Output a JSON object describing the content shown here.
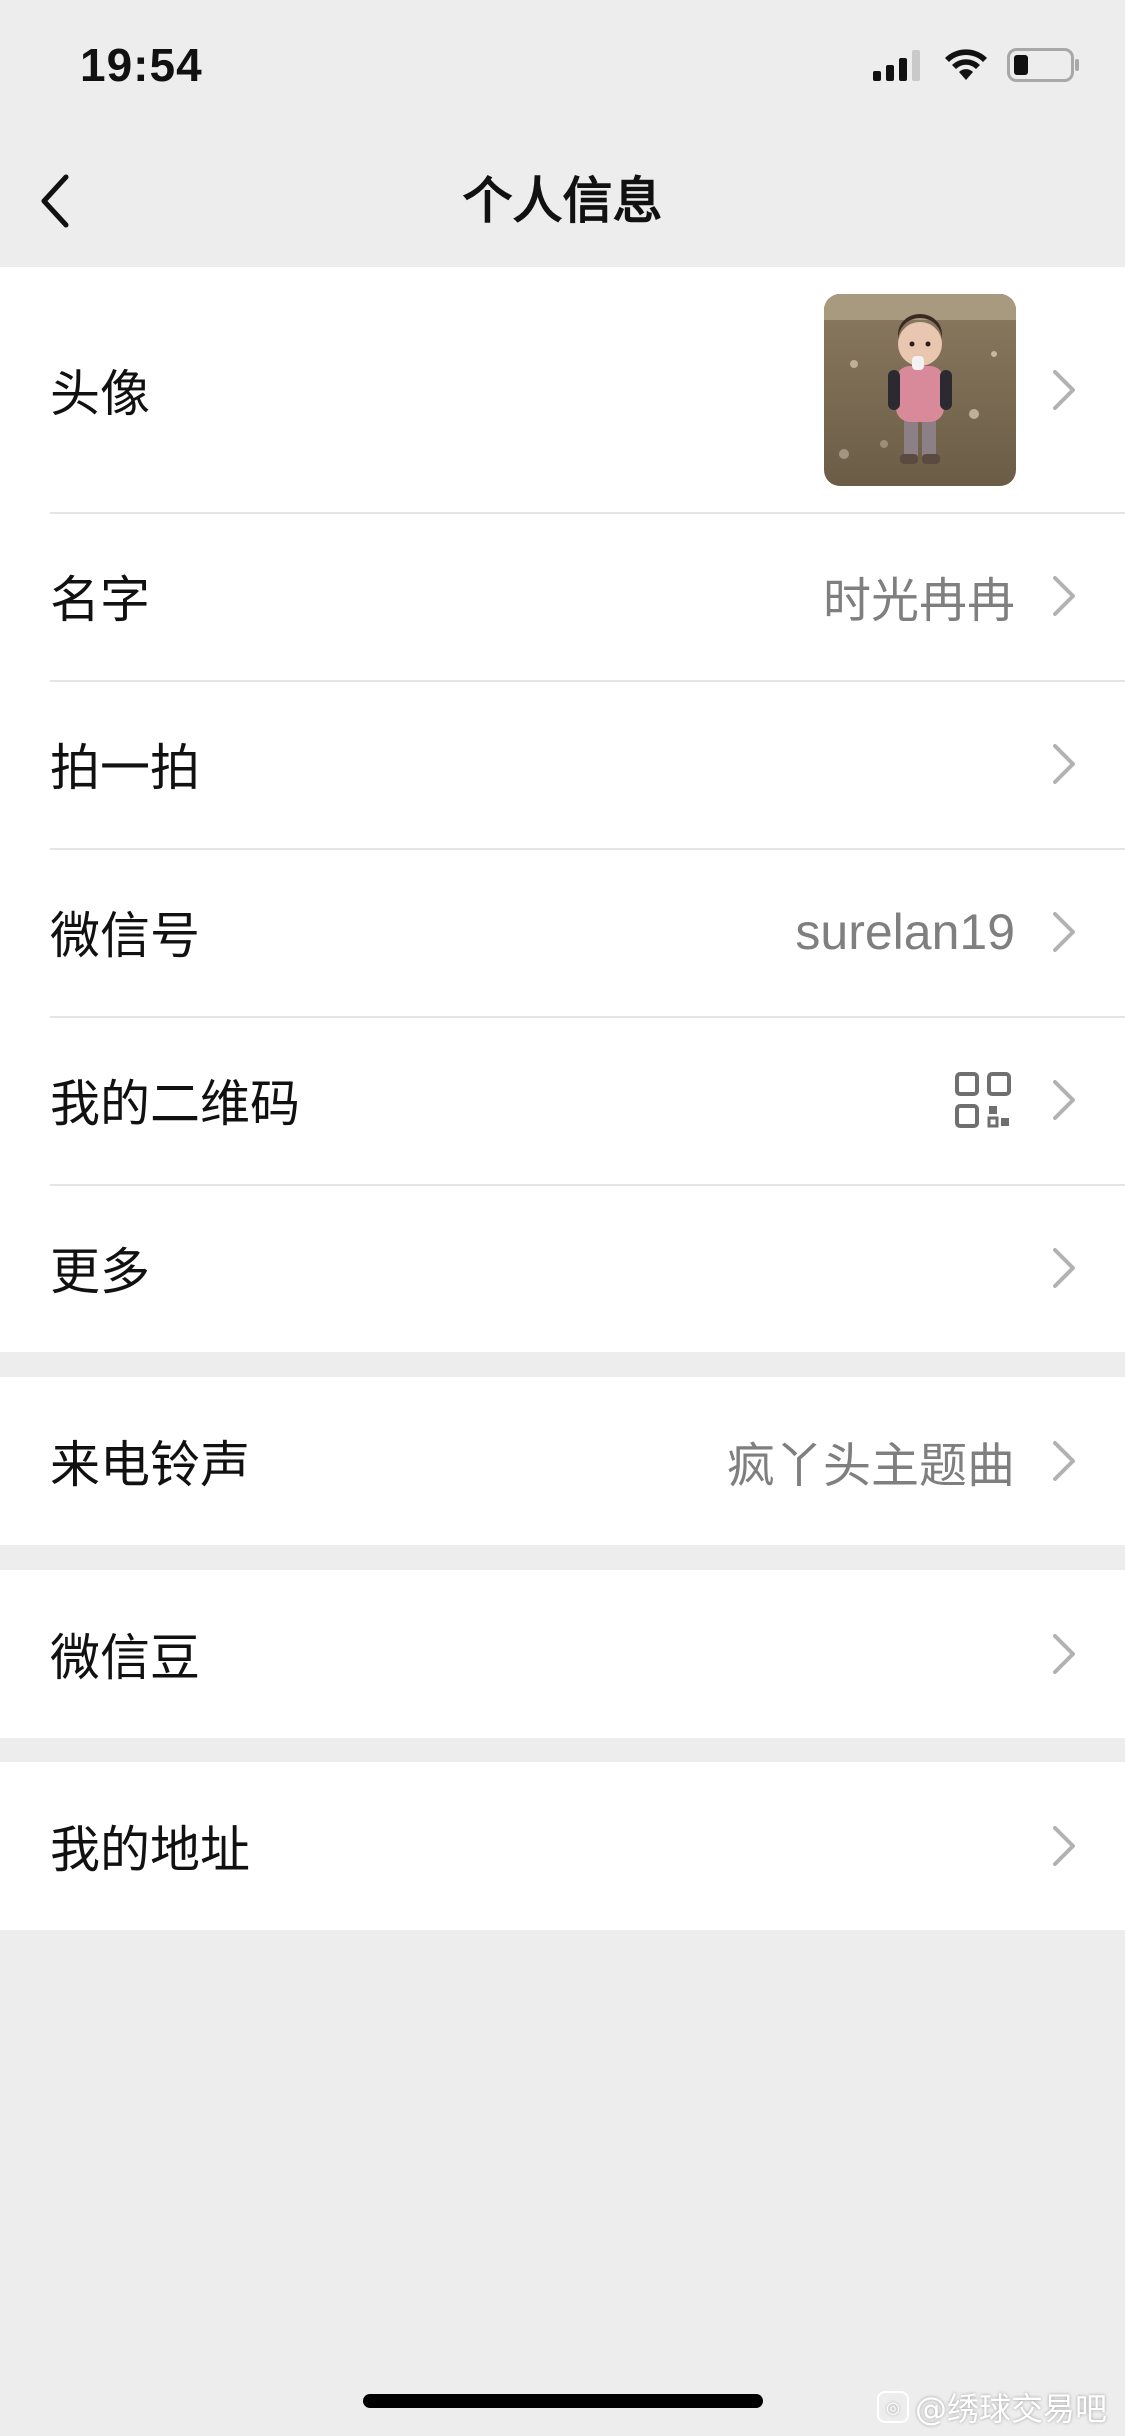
{
  "status_bar": {
    "time": "19:54",
    "icons": [
      "cellular-signal-icon",
      "wifi-icon",
      "battery-icon"
    ]
  },
  "nav": {
    "back_icon": "chevron-left-icon",
    "title": "个人信息"
  },
  "profile_group": {
    "avatar_label": "头像",
    "rows": [
      {
        "label": "名字",
        "value": "时光冉冉"
      },
      {
        "label": "拍一拍",
        "value": ""
      },
      {
        "label": "微信号",
        "value": "surelan19"
      },
      {
        "label": "我的二维码",
        "value": ""
      },
      {
        "label": "更多",
        "value": ""
      }
    ]
  },
  "ringtone_group": {
    "label": "来电铃声",
    "value": "疯丫头主题曲"
  },
  "beans_group": {
    "label": "微信豆"
  },
  "address_group": {
    "label": "我的地址"
  },
  "watermark": {
    "text": "@绣球交易吧"
  },
  "colors": {
    "background": "#ededed",
    "card": "#ffffff",
    "secondary_text": "#7f7f7f",
    "chevron": "#b2b2b2"
  }
}
